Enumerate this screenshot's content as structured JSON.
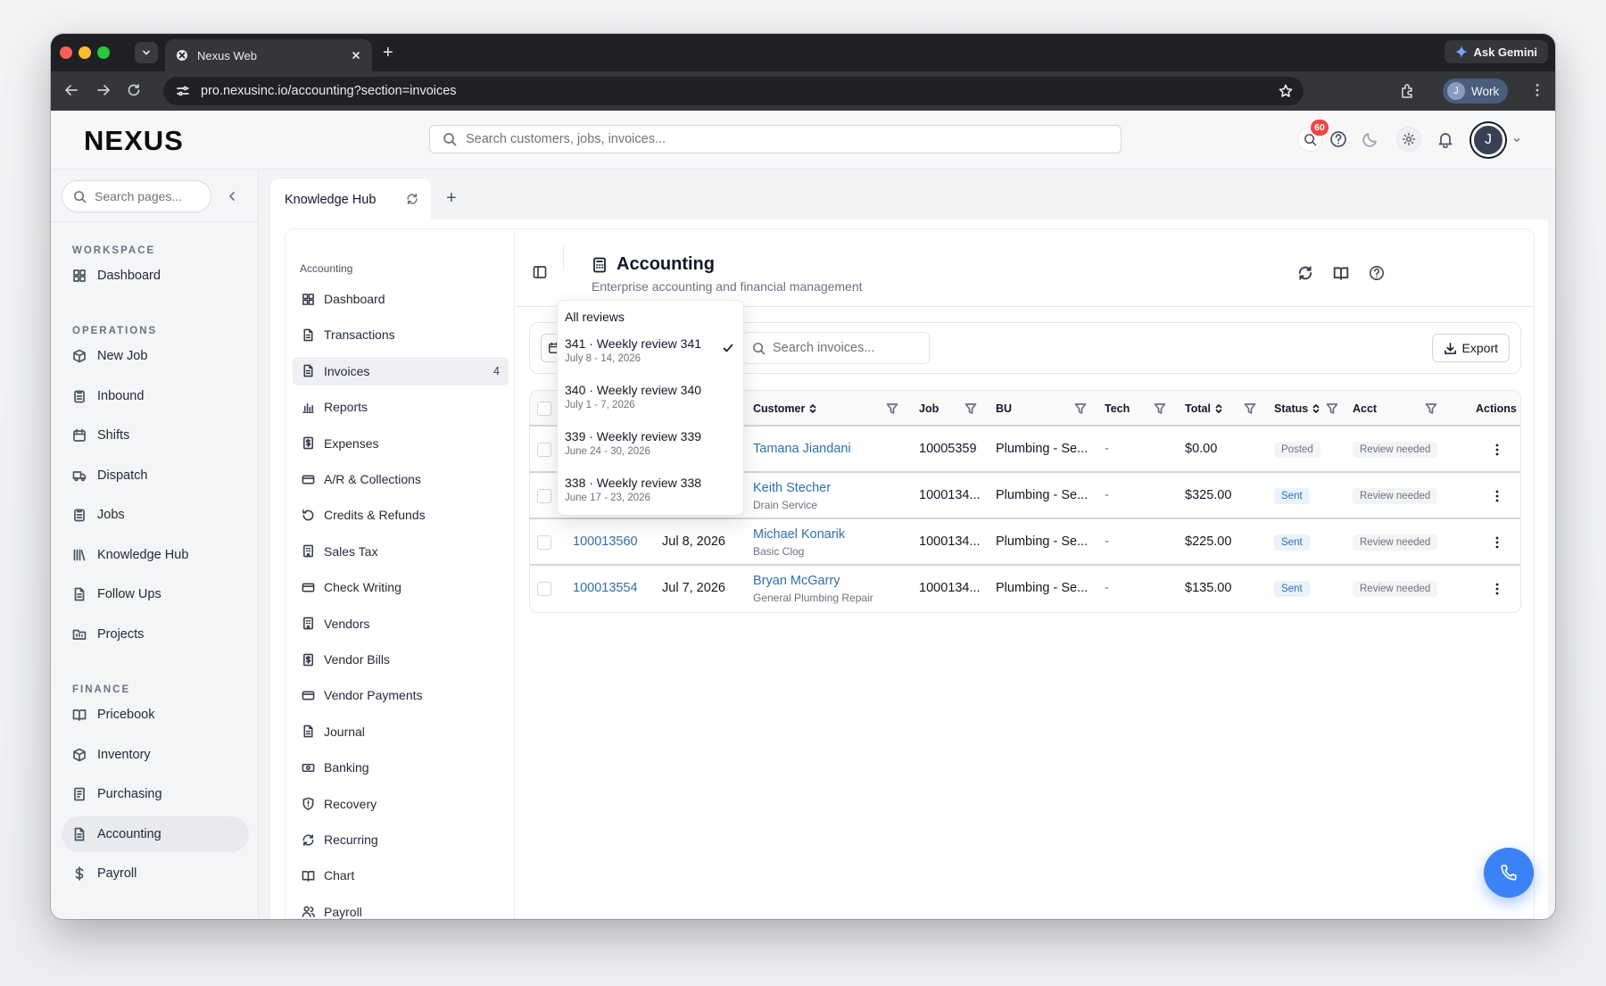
{
  "browser": {
    "tab_title": "Nexus Web",
    "url": "pro.nexusinc.io/accounting?section=invoices",
    "gemini_label": "Ask Gemini",
    "profile_initial": "J",
    "profile_label": "Work"
  },
  "app": {
    "logo": "NEXUS",
    "search_placeholder": "Search customers, jobs, invoices...",
    "notifications_count": "60",
    "user_initial": "J"
  },
  "sidebar": {
    "search_placeholder": "Search pages...",
    "sections": [
      {
        "title": "WORKSPACE"
      },
      {
        "title": "OPERATIONS"
      },
      {
        "title": "FINANCE"
      }
    ],
    "items": [
      {
        "label": "Dashboard",
        "icon": "grid-icon"
      },
      {
        "label": "New Job",
        "icon": "cube-icon"
      },
      {
        "label": "Inbound",
        "icon": "clipboard-icon"
      },
      {
        "label": "Shifts",
        "icon": "calendar-icon"
      },
      {
        "label": "Dispatch",
        "icon": "truck-icon"
      },
      {
        "label": "Jobs",
        "icon": "clipboard-icon"
      },
      {
        "label": "Knowledge Hub",
        "icon": "library-icon"
      },
      {
        "label": "Follow Ups",
        "icon": "document-icon"
      },
      {
        "label": "Projects",
        "icon": "folder-icon"
      },
      {
        "label": "Pricebook",
        "icon": "book-icon"
      },
      {
        "label": "Inventory",
        "icon": "cube-icon"
      },
      {
        "label": "Purchasing",
        "icon": "receipt-icon"
      },
      {
        "label": "Accounting",
        "icon": "document-icon"
      },
      {
        "label": "Payroll",
        "icon": "dollar-icon"
      }
    ]
  },
  "tabs": {
    "active": "Knowledge Hub"
  },
  "subnav": {
    "title": "Accounting",
    "items": [
      {
        "label": "Dashboard"
      },
      {
        "label": "Transactions"
      },
      {
        "label": "Invoices",
        "count": "4"
      },
      {
        "label": "Reports"
      },
      {
        "label": "Expenses"
      },
      {
        "label": "A/R & Collections"
      },
      {
        "label": "Credits & Refunds"
      },
      {
        "label": "Sales Tax"
      },
      {
        "label": "Check Writing"
      },
      {
        "label": "Vendors"
      },
      {
        "label": "Vendor Bills"
      },
      {
        "label": "Vendor Payments"
      },
      {
        "label": "Journal"
      },
      {
        "label": "Banking"
      },
      {
        "label": "Recovery"
      },
      {
        "label": "Recurring"
      },
      {
        "label": "Chart"
      },
      {
        "label": "Payroll"
      }
    ]
  },
  "page": {
    "title": "Accounting",
    "subtitle": "Enterprise accounting and financial management",
    "search_placeholder": "Search invoices...",
    "export_label": "Export"
  },
  "table": {
    "headers": {
      "customer": "Customer",
      "job": "Job",
      "bu": "BU",
      "tech": "Tech",
      "total": "Total",
      "status": "Status",
      "acct": "Acct",
      "actions": "Actions"
    },
    "rows": [
      {
        "invoice": "",
        "date": "",
        "customer": "Tamana Jiandani",
        "customer_sub": "",
        "job": "10005359",
        "bu": "Plumbing - Se...",
        "tech": "-",
        "total": "$0.00",
        "status": "Posted",
        "acct": "Review needed"
      },
      {
        "invoice": "",
        "date": "",
        "customer": "Keith Stecher",
        "customer_sub": "Drain Service",
        "job": "1000134...",
        "bu": "Plumbing - Se...",
        "tech": "-",
        "total": "$325.00",
        "status": "Sent",
        "acct": "Review needed"
      },
      {
        "invoice": "100013560",
        "date": "Jul 8, 2026",
        "customer": "Michael Konarik",
        "customer_sub": "Basic Clog",
        "job": "1000134...",
        "bu": "Plumbing - Se...",
        "tech": "-",
        "total": "$225.00",
        "status": "Sent",
        "acct": "Review needed"
      },
      {
        "invoice": "100013554",
        "date": "Jul 7, 2026",
        "customer": "Bryan McGarry",
        "customer_sub": "General Plumbing Repair",
        "job": "1000134...",
        "bu": "Plumbing - Se...",
        "tech": "-",
        "total": "$135.00",
        "status": "Sent",
        "acct": "Review needed"
      }
    ]
  },
  "review_dropdown": {
    "all_label": "All reviews",
    "options": [
      {
        "label": "341 · Weekly review 341",
        "dates": "July 8 - 14, 2026",
        "selected": true
      },
      {
        "label": "340 · Weekly review 340",
        "dates": "July 1 - 7, 2026"
      },
      {
        "label": "339 · Weekly review 339",
        "dates": "June 24 - 30, 2026"
      },
      {
        "label": "338 · Weekly review 338",
        "dates": "June 17 - 23, 2026"
      }
    ]
  },
  "colors": {
    "accent": "#3b82f6",
    "link": "#2f6fae",
    "badge": "#ef4444"
  }
}
